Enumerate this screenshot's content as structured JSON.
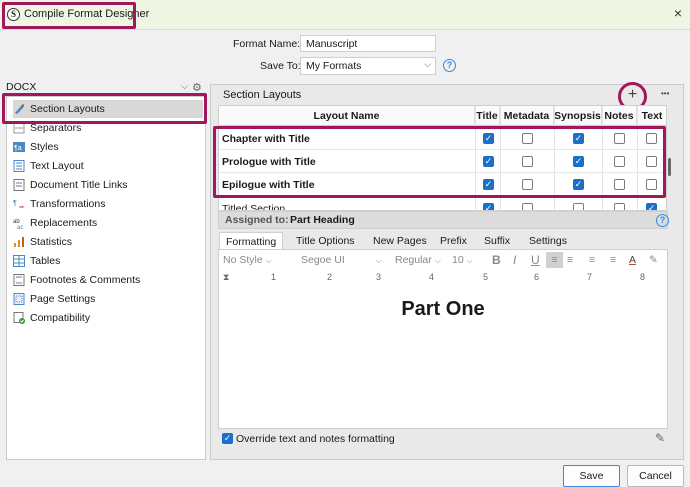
{
  "window": {
    "title": "Compile Format Designer",
    "close": "×",
    "app_icon": "S"
  },
  "format": {
    "name_label": "Format Name:",
    "name_value": "Manuscript",
    "save_label": "Save To:",
    "save_value": "My Formats",
    "help": "?"
  },
  "left": {
    "doc_type": "DOCX",
    "items": [
      {
        "label": "Section Layouts",
        "icon": "brush-icon"
      },
      {
        "label": "Separators",
        "icon": "separators-icon"
      },
      {
        "label": "Styles",
        "icon": "styles-icon"
      },
      {
        "label": "Text Layout",
        "icon": "text-layout-icon"
      },
      {
        "label": "Document Title Links",
        "icon": "title-links-icon"
      },
      {
        "label": "Transformations",
        "icon": "transformations-icon"
      },
      {
        "label": "Replacements",
        "icon": "replacements-icon"
      },
      {
        "label": "Statistics",
        "icon": "statistics-icon"
      },
      {
        "label": "Tables",
        "icon": "tables-icon"
      },
      {
        "label": "Footnotes & Comments",
        "icon": "footnotes-icon"
      },
      {
        "label": "Page Settings",
        "icon": "page-settings-icon"
      },
      {
        "label": "Compatibility",
        "icon": "compatibility-icon"
      }
    ]
  },
  "section": {
    "title": "Section Layouts",
    "add": "+",
    "more": "•••",
    "columns": [
      "Layout Name",
      "Title",
      "Metadata",
      "Synopsis",
      "Notes",
      "Text"
    ],
    "rows": [
      {
        "name": "Chapter with Title",
        "title": true,
        "metadata": false,
        "synopsis": true,
        "notes": false,
        "text": false
      },
      {
        "name": "Prologue with Title",
        "title": true,
        "metadata": false,
        "synopsis": true,
        "notes": false,
        "text": false
      },
      {
        "name": "Epilogue with Title",
        "title": true,
        "metadata": false,
        "synopsis": true,
        "notes": false,
        "text": false
      },
      {
        "name": "Titled Section",
        "title": true,
        "metadata": false,
        "synopsis": false,
        "notes": false,
        "text": true
      }
    ],
    "assigned_label": "Assigned to:",
    "assigned_value": "Part Heading"
  },
  "tabs": [
    "Formatting",
    "Title Options",
    "New Pages",
    "Prefix",
    "Suffix",
    "Settings"
  ],
  "toolbar": {
    "style": "No Style",
    "font": "Segoe UI",
    "weight": "Regular",
    "size": "10",
    "bold": "B",
    "italic": "I",
    "underline": "U"
  },
  "ruler": [
    "1",
    "2",
    "3",
    "4",
    "5",
    "6",
    "7",
    "8"
  ],
  "preview_text": "Part One",
  "override_label": "Override text and notes formatting",
  "buttons": {
    "save": "Save",
    "cancel": "Cancel"
  }
}
